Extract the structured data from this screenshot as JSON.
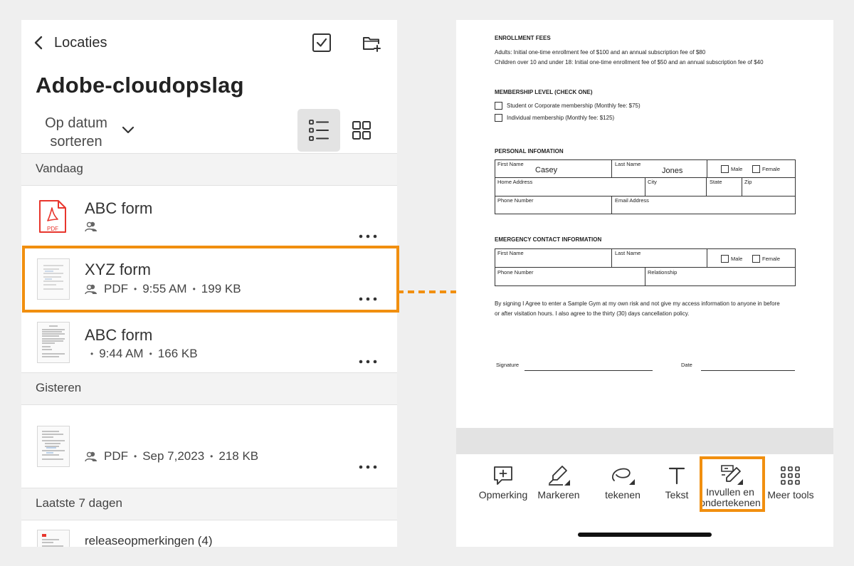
{
  "header": {
    "back_label": "Locaties",
    "title": "Adobe-cloudopslag",
    "sort_label": "Op datum sorteren"
  },
  "sections": [
    {
      "label": "Vandaag"
    },
    {
      "label": "Gisteren"
    },
    {
      "label": "Laatste 7 dagen"
    }
  ],
  "files": [
    {
      "name": "ABC form",
      "type": "",
      "time": "",
      "size": ""
    },
    {
      "name": "XYZ form",
      "type": "PDF",
      "time": "9:55 AM",
      "size": "199 KB"
    },
    {
      "name": "ABC form",
      "type": "",
      "time": "9:44 AM",
      "size": "166 KB"
    },
    {
      "name": "",
      "type": "PDF",
      "time": "Sep 7,2023",
      "size": "218 KB"
    },
    {
      "name": "releaseopmerkingen (4)"
    }
  ],
  "pdf_badge": "PDF",
  "document": {
    "fees_title": "ENROLLMENT FEES",
    "fees_line1": "Adults: Initial one-time enrollment fee of $100 and an annual subscription fee of $80",
    "fees_line2": "Children over 10 and under 18: Initial one-time enrollment fee of $50 and an annual subscription fee of $40",
    "membership_title": "MEMBERSHIP LEVEL (CHECK ONE)",
    "membership_opt1": "Student or Corporate membership (Monthly fee: $75)",
    "membership_opt2": "Individual membership (Monthly fee: $125)",
    "personal_title": "PERSONAL INFOMATION",
    "first_name_label": "First Name",
    "first_name_value": "Casey",
    "last_name_label": "Last Name",
    "last_name_value": "Jones",
    "male_label": "Male",
    "female_label": "Female",
    "home_address_label": "Home Address",
    "city_label": "City",
    "state_label": "State",
    "zip_label": "Zip",
    "phone_label": "Phone Number",
    "email_label": "Email Address",
    "emergency_title": "EMERGENCY CONTACT INFORMATION",
    "relationship_label": "Relationship",
    "agreement_line1": "By signing I Agree to enter a Sample Gym at my own risk and not give my access information to anyone in before",
    "agreement_line2": "or after visitation hours. I also agree to the thirty (30) days cancellation policy.",
    "signature_label": "Signature",
    "date_label": "Date"
  },
  "toolbar": {
    "comment": "Opmerking",
    "highlight": "Markeren",
    "draw": "tekenen",
    "text": "Tekst",
    "fill_sign": "Invullen en ondertekenen",
    "more_tools": "Meer tools"
  },
  "colors": {
    "accent": "#f18f0f",
    "pdf_red": "#e8362d"
  }
}
